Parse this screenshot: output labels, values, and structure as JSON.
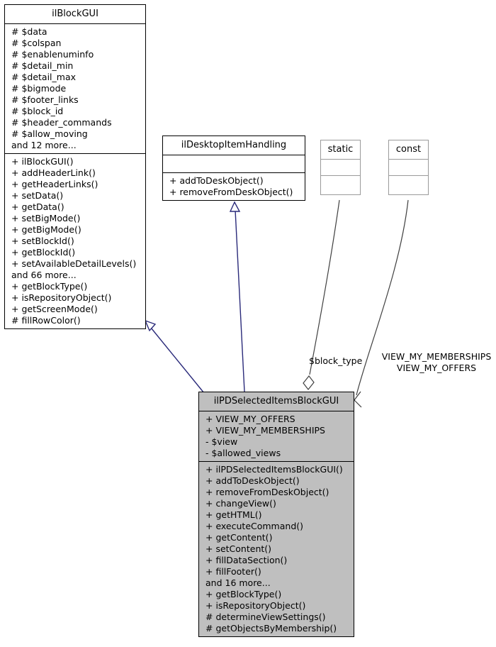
{
  "diagram": {
    "type": "uml-class-diagram",
    "background": "#ffffff",
    "colors": {
      "inheritance_edge": "#2a2a7a",
      "association_edge": "#404040",
      "highlight_fill": "#bfbfbf",
      "box_border": "#000000",
      "light_box_border": "#9a9a9a"
    }
  },
  "classes": {
    "ilBlockGUI": {
      "name": "ilBlockGUI",
      "attributes": [
        "# $data",
        "# $colspan",
        "# $enablenuminfo",
        "# $detail_min",
        "# $detail_max",
        "# $bigmode",
        "# $footer_links",
        "# $block_id",
        "# $header_commands",
        "# $allow_moving",
        "and 12 more..."
      ],
      "methods": [
        "+ ilBlockGUI()",
        "+ addHeaderLink()",
        "+ getHeaderLinks()",
        "+ setData()",
        "+ getData()",
        "+ setBigMode()",
        "+ getBigMode()",
        "+ setBlockId()",
        "+ getBlockId()",
        "+ setAvailableDetailLevels()",
        "and 66 more...",
        "+ getBlockType()",
        "+ isRepositoryObject()",
        "+ getScreenMode()",
        "# fillRowColor()"
      ]
    },
    "ilDesktopItemHandling": {
      "name": "ilDesktopItemHandling",
      "attributes": [],
      "methods": [
        "+ addToDeskObject()",
        "+ removeFromDeskObject()"
      ]
    },
    "static": {
      "name": "static",
      "attributes": [],
      "methods": []
    },
    "const": {
      "name": "const",
      "attributes": [],
      "methods": []
    },
    "ilPDSelectedItemsBlockGUI": {
      "name": "ilPDSelectedItemsBlockGUI",
      "attributes": [
        "+ VIEW_MY_OFFERS",
        "+ VIEW_MY_MEMBERSHIPS",
        "- $view",
        "- $allowed_views"
      ],
      "methods": [
        "+ ilPDSelectedItemsBlockGUI()",
        "+ addToDeskObject()",
        "+ removeFromDeskObject()",
        "+ changeView()",
        "+ getHTML()",
        "+ executeCommand()",
        "+ getContent()",
        "+ setContent()",
        "+ fillDataSection()",
        "+ fillFooter()",
        "and 16 more...",
        "+ getBlockType()",
        "+ isRepositoryObject()",
        "# determineViewSettings()",
        "# getObjectsByMembership()"
      ]
    }
  },
  "edges": [
    {
      "id": "inherit-ilblockgui",
      "from": "ilPDSelectedItemsBlockGUI",
      "to": "ilBlockGUI",
      "kind": "inheritance",
      "label": ""
    },
    {
      "id": "inherit-ildesktopitemhandling",
      "from": "ilPDSelectedItemsBlockGUI",
      "to": "ilDesktopItemHandling",
      "kind": "inheritance",
      "label": ""
    },
    {
      "id": "assoc-block-type",
      "from": "static",
      "to": "ilPDSelectedItemsBlockGUI",
      "kind": "aggregation",
      "label": "$block_type"
    },
    {
      "id": "assoc-views",
      "from": "const",
      "to": "ilPDSelectedItemsBlockGUI",
      "kind": "association",
      "label_line1": "VIEW_MY_MEMBERSHIPS",
      "label_line2": "VIEW_MY_OFFERS"
    }
  ]
}
